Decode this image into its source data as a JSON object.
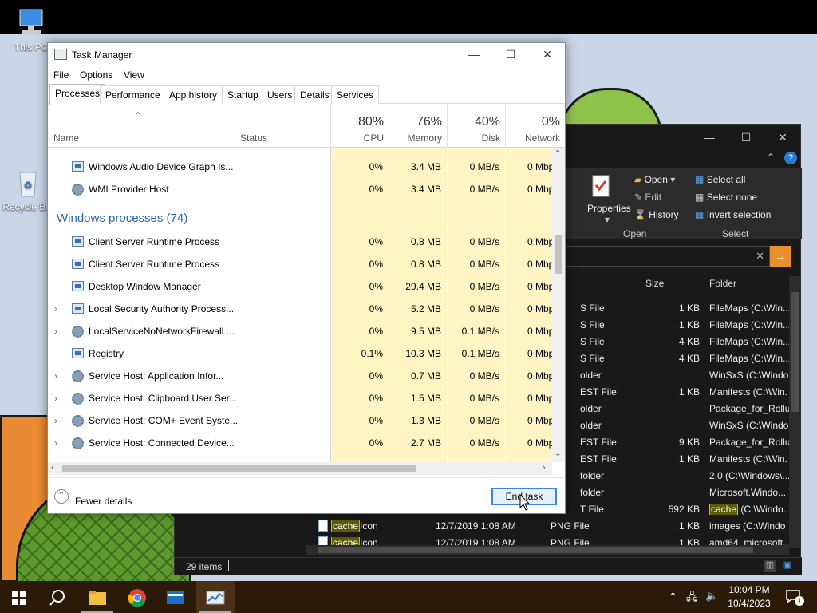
{
  "desktop": {
    "icons": [
      {
        "label": "This PC"
      },
      {
        "label": "Recycle Bin"
      }
    ]
  },
  "explorer": {
    "ribbon": {
      "properties_label": "Properties",
      "open_label": "Open",
      "edit_label": "Edit",
      "history_label": "History",
      "select_all_label": "Select all",
      "select_none_label": "Select none",
      "invert_selection_label": "Invert selection",
      "group_open": "Open",
      "group_select": "Select"
    },
    "columns": {
      "size": "Size",
      "folder": "Folder"
    },
    "rows": [
      {
        "type": "S File",
        "size": "1 KB",
        "folder": "FileMaps (C:\\Win..."
      },
      {
        "type": "S File",
        "size": "1 KB",
        "folder": "FileMaps (C:\\Win..."
      },
      {
        "type": "S File",
        "size": "4 KB",
        "folder": "FileMaps (C:\\Win..."
      },
      {
        "type": "S File",
        "size": "4 KB",
        "folder": "FileMaps (C:\\Win..."
      },
      {
        "type": "older",
        "size": "",
        "folder": "WinSxS (C:\\Windo"
      },
      {
        "type": "EST File",
        "size": "1 KB",
        "folder": "Manifests (C:\\Win."
      },
      {
        "type": "older",
        "size": "",
        "folder": "Package_for_Rollu"
      },
      {
        "type": "older",
        "size": "",
        "folder": "WinSxS (C:\\Windo"
      },
      {
        "type": "EST File",
        "size": "9 KB",
        "folder": "Package_for_Rollu"
      },
      {
        "type": "EST File",
        "size": "1 KB",
        "folder": "Manifests (C:\\Win."
      },
      {
        "type": "folder",
        "size": "",
        "folder": "2.0 (C:\\Windows\\..."
      },
      {
        "type": "folder",
        "size": "",
        "folder": "Microsoft.Windo..."
      },
      {
        "type": "T File",
        "size": "592 KB",
        "folder_hl": "cache",
        "folder_rest": " (C:\\Windo..."
      }
    ],
    "bottom_rows": [
      {
        "name_hl": "cache",
        "name_rest": "Icon",
        "date": "12/7/2019 1:08 AM",
        "type": "PNG File",
        "size": "1 KB",
        "folder": "images (C:\\Windo"
      },
      {
        "name_hl": "cache",
        "name_rest": "Icon",
        "date": "12/7/2019 1:08 AM",
        "type": "PNG File",
        "size": "1 KB",
        "folder": "amd64_microsoft..."
      }
    ],
    "status": "29 items"
  },
  "taskmanager": {
    "title": "Task Manager",
    "menu": [
      "File",
      "Options",
      "View"
    ],
    "tabs": [
      "Processes",
      "Performance",
      "App history",
      "Startup",
      "Users",
      "Details",
      "Services"
    ],
    "header": {
      "name": "Name",
      "status": "Status",
      "cpu_pct": "80%",
      "cpu": "CPU",
      "mem_pct": "76%",
      "mem": "Memory",
      "disk_pct": "40%",
      "disk": "Disk",
      "net_pct": "0%",
      "net": "Network"
    },
    "top_rows": [
      {
        "name": "Windows Audio Device Graph Is...",
        "cpu": "0%",
        "mem": "3.4 MB",
        "disk": "0 MB/s",
        "net": "0 Mbp"
      },
      {
        "name": "WMI Provider Host",
        "cpu": "0%",
        "mem": "3.4 MB",
        "disk": "0 MB/s",
        "net": "0 Mbp"
      }
    ],
    "group_label": "Windows processes (74)",
    "rows": [
      {
        "name": "Client Server Runtime Process",
        "cpu": "0%",
        "mem": "0.8 MB",
        "disk": "0 MB/s",
        "net": "0 Mbp"
      },
      {
        "name": "Client Server Runtime Process",
        "cpu": "0%",
        "mem": "0.8 MB",
        "disk": "0 MB/s",
        "net": "0 Mbp"
      },
      {
        "name": "Desktop Window Manager",
        "cpu": "0%",
        "mem": "29.4 MB",
        "disk": "0 MB/s",
        "net": "0 Mbp"
      },
      {
        "name": "Local Security Authority Process...",
        "cpu": "0%",
        "mem": "5.2 MB",
        "disk": "0 MB/s",
        "net": "0 Mbp"
      },
      {
        "name": "LocalServiceNoNetworkFirewall ...",
        "cpu": "0%",
        "mem": "9.5 MB",
        "disk": "0.1 MB/s",
        "net": "0 Mbp"
      },
      {
        "name": "Registry",
        "cpu": "0.1%",
        "mem": "10.3 MB",
        "disk": "0.1 MB/s",
        "net": "0 Mbp"
      },
      {
        "name": "Service Host: Application Infor...",
        "cpu": "0%",
        "mem": "0.7 MB",
        "disk": "0 MB/s",
        "net": "0 Mbp"
      },
      {
        "name": "Service Host: Clipboard User Ser...",
        "cpu": "0%",
        "mem": "1.5 MB",
        "disk": "0 MB/s",
        "net": "0 Mbp"
      },
      {
        "name": "Service Host: COM+ Event Syste...",
        "cpu": "0%",
        "mem": "1.3 MB",
        "disk": "0 MB/s",
        "net": "0 Mbp"
      },
      {
        "name": "Service Host: Connected Device...",
        "cpu": "0%",
        "mem": "2.7 MB",
        "disk": "0 MB/s",
        "net": "0 Mbp"
      }
    ],
    "fewer_details": "Fewer details",
    "end_task": "End task"
  },
  "taskbar": {
    "time": "10:04 PM",
    "date": "10/4/2023",
    "notification_count": "1"
  }
}
